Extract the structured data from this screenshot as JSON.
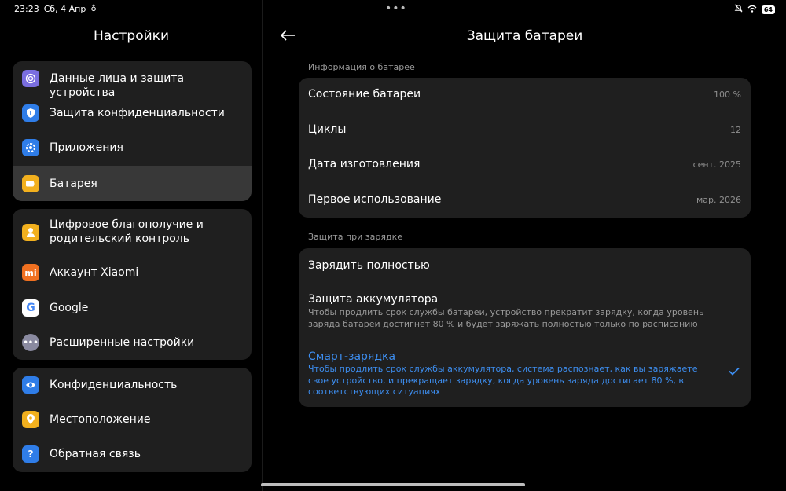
{
  "status": {
    "time": "23:23",
    "date": "Сб, 4 Апр",
    "battery": "64"
  },
  "left": {
    "title": "Настройки",
    "groups": [
      {
        "items": [
          {
            "label": "Данные лица и защита устройства",
            "icon": "face-id-icon",
            "color": "#7a6ee0"
          },
          {
            "label": "Защита конфиденциальности",
            "icon": "privacy-shield-icon",
            "color": "#2f7de8"
          },
          {
            "label": "Приложения",
            "icon": "apps-gear-icon",
            "color": "#2f7de8"
          },
          {
            "label": "Батарея",
            "icon": "battery-icon",
            "color": "#f2b01e",
            "selected": true
          }
        ]
      },
      {
        "items": [
          {
            "label": "Цифровое благополучие и родительский контроль",
            "icon": "wellbeing-icon",
            "color": "#f2b01e"
          },
          {
            "label": "Аккаунт Xiaomi",
            "icon": "xiaomi-icon",
            "color": "#f07020"
          },
          {
            "label": "Google",
            "icon": "google-icon",
            "color": "#ffffff"
          },
          {
            "label": "Расширенные настройки",
            "icon": "more-icon",
            "color": "#8a8aa0"
          }
        ]
      },
      {
        "items": [
          {
            "label": "Конфиденциальность",
            "icon": "eye-icon",
            "color": "#2f7de8"
          },
          {
            "label": "Местоположение",
            "icon": "location-icon",
            "color": "#f2b01e"
          },
          {
            "label": "Обратная связь",
            "icon": "feedback-icon",
            "color": "#2f7de8"
          }
        ]
      }
    ]
  },
  "right": {
    "title": "Защита батареи",
    "info_section": "Информация о батарее",
    "info": [
      {
        "label": "Состояние батареи",
        "value": "100 %"
      },
      {
        "label": "Циклы",
        "value": "12"
      },
      {
        "label": "Дата изготовления",
        "value": "сент. 2025"
      },
      {
        "label": "Первое использование",
        "value": "мар. 2026"
      }
    ],
    "charge_section": "Защита при зарядке",
    "options": {
      "full": "Зарядить полностью",
      "protect_title": "Защита аккумулятора",
      "protect_desc": "Чтобы продлить срок службы батареи, устройство прекратит зарядку, когда уровень заряда батареи достигнет 80 % и будет заряжать полностью только по расписанию",
      "smart_title": "Смарт-зарядка",
      "smart_desc": "Чтобы продлить срок службы аккумулятора, система распознает, как вы заряжаете свое устройство, и прекращает зарядку, когда уровень заряда достигает 80 %, в соответствующих ситуациях"
    },
    "accent": "#3d8ef0"
  }
}
